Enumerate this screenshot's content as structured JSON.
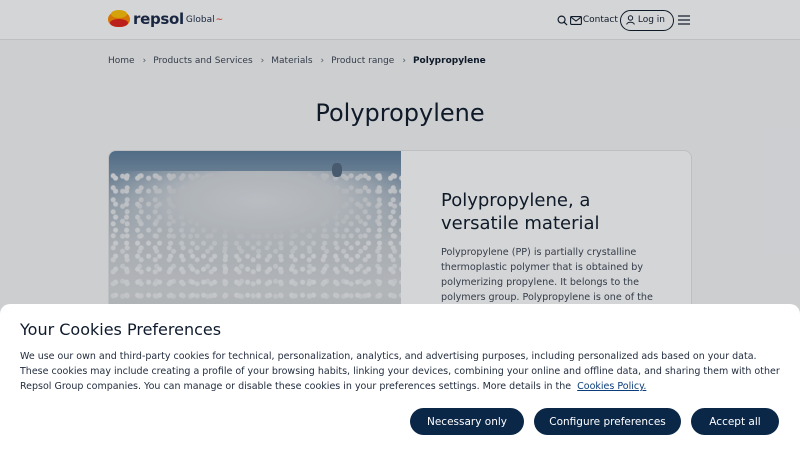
{
  "header": {
    "brand": "repsol",
    "brand_sub": "Global",
    "contact_label": "Contact",
    "login_label": "Log in"
  },
  "breadcrumb": {
    "items": [
      "Home",
      "Products and Services",
      "Materials",
      "Product range"
    ],
    "current": "Polypropylene"
  },
  "page": {
    "title": "Polypropylene"
  },
  "card": {
    "title": "Polypropylene, a versatile material",
    "text": "Polypropylene (PP) is partially crystalline thermoplastic polymer that is obtained by polymerizing propylene. It belongs to the polymers group. Polypropylene is one of the"
  },
  "cookies": {
    "title": "Your Cookies Preferences",
    "text": "We use our own and third-party cookies for technical, personalization, analytics, and advertising purposes, including personalized ads based on your data. These cookies may include creating a profile of your browsing habits, linking your devices, combining your online and offline data, and sharing them with other Repsol Group companies. You can manage or disable these cookies in your preferences settings. More details in the",
    "link_label": "Cookies Policy.",
    "buttons": {
      "necessary": "Necessary only",
      "configure": "Configure preferences",
      "accept": "Accept all"
    }
  },
  "colors": {
    "primary_button": "#0b2748",
    "logo_orange": "#ff8a00",
    "logo_red": "#e2231a",
    "logo_yellow": "#ffc107"
  },
  "icons": [
    "search-icon",
    "mail-icon",
    "user-icon",
    "hamburger-menu-icon",
    "chevron-right-icon"
  ]
}
